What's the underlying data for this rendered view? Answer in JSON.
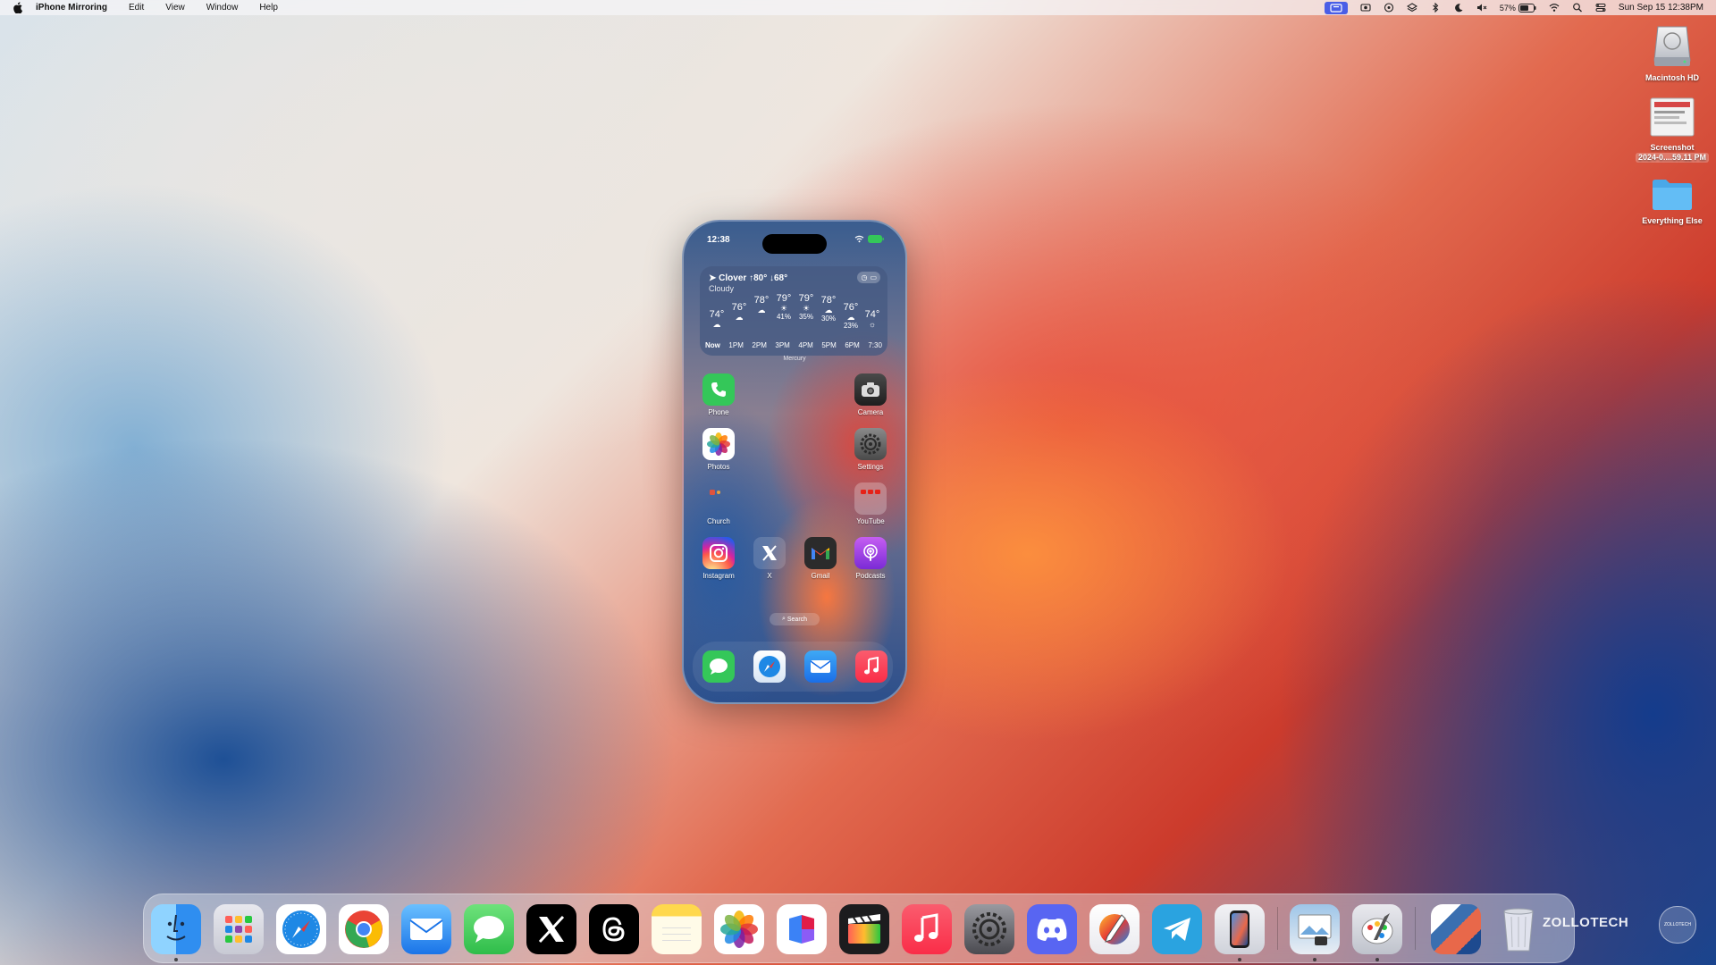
{
  "menubar": {
    "app_name": "iPhone Mirroring",
    "menus": [
      "Edit",
      "View",
      "Window",
      "Help"
    ],
    "battery": "57%",
    "clock": "Sun Sep 15  12:38PM"
  },
  "desktop": {
    "icons": [
      {
        "label": "Macintosh HD",
        "icon": "hard-drive-icon"
      },
      {
        "label": "Screenshot",
        "sub": "2024-0....59.11 PM",
        "icon": "screenshot-file-icon"
      },
      {
        "label": "Everything Else",
        "icon": "folder-icon"
      }
    ]
  },
  "phone": {
    "time": "12:38",
    "weather": {
      "location": "Clover",
      "high": "↑80°",
      "low": "↓68°",
      "condition": "Cloudy",
      "hours": [
        {
          "temp": "74°",
          "pct": "",
          "time": "Now"
        },
        {
          "temp": "76°",
          "pct": "",
          "time": "1PM"
        },
        {
          "temp": "78°",
          "pct": "",
          "time": "2PM"
        },
        {
          "temp": "79°",
          "pct": "41%",
          "time": "3PM"
        },
        {
          "temp": "79°",
          "pct": "35%",
          "time": "4PM"
        },
        {
          "temp": "78°",
          "pct": "30%",
          "time": "5PM"
        },
        {
          "temp": "76°",
          "pct": "23%",
          "time": "6PM"
        },
        {
          "temp": "74°",
          "pct": "",
          "time": "7:30"
        }
      ],
      "caption": "Mercury"
    },
    "apps": {
      "phone": "Phone",
      "camera": "Camera",
      "photos": "Photos",
      "settings": "Settings",
      "church": "Church",
      "youtube": "YouTube",
      "instagram": "Instagram",
      "x": "X",
      "gmail": "Gmail",
      "podcasts": "Podcasts"
    },
    "search": "Search"
  },
  "watermark": "ZOLLOTECH",
  "watermark_badge": "ZOLLOTECH",
  "colors": {
    "menubar_active": "#4a5ee6",
    "phone_green": "#34c759",
    "safari_blue": "#1e88e5",
    "music_red": "#fa2d48",
    "folder_blue": "#4aa8e8"
  }
}
